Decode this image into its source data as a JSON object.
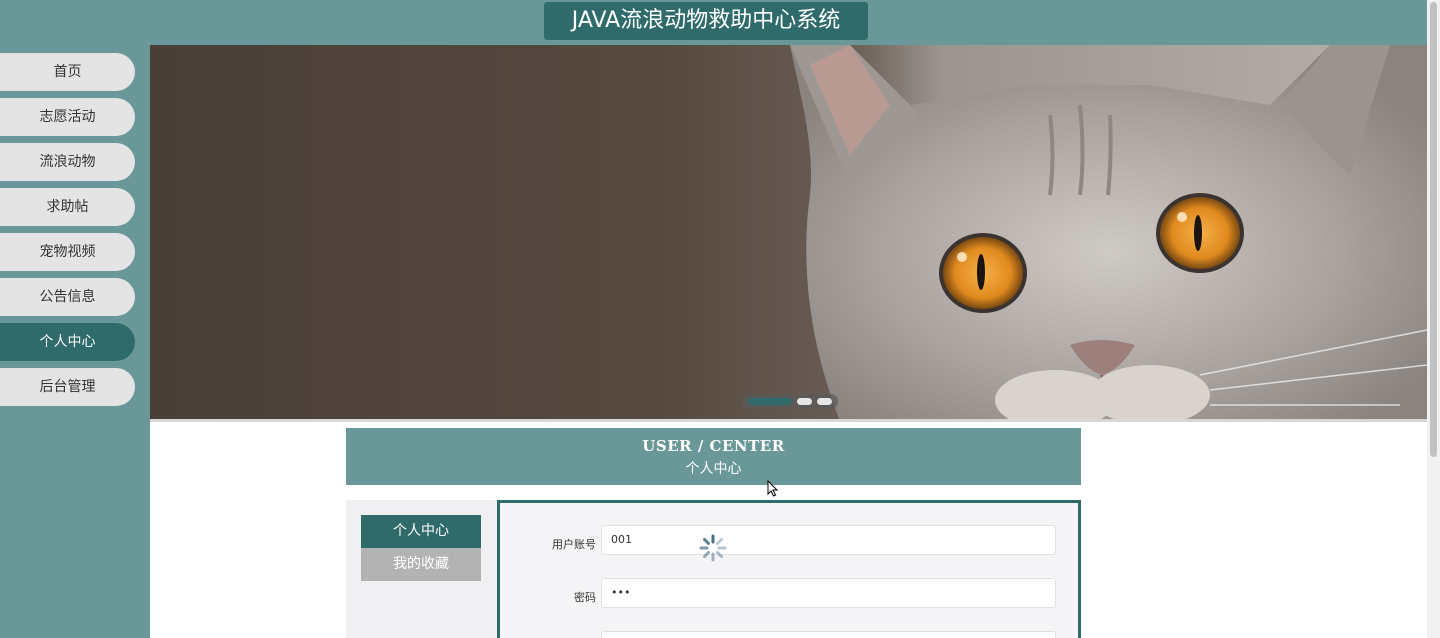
{
  "header": {
    "title": "JAVA流浪动物救助中心系统"
  },
  "sidebar": {
    "items": [
      {
        "label": "首页"
      },
      {
        "label": "志愿活动"
      },
      {
        "label": "流浪动物"
      },
      {
        "label": "求助帖"
      },
      {
        "label": "宠物视频"
      },
      {
        "label": "公告信息"
      },
      {
        "label": "个人中心",
        "active": true
      },
      {
        "label": "后台管理"
      }
    ]
  },
  "banner": {
    "slide_count": 3,
    "active_slide": 1
  },
  "section": {
    "title_en": "USER / CENTER",
    "title_cn": "个人中心"
  },
  "side_tabs": [
    {
      "label": "个人中心",
      "active": true
    },
    {
      "label": "我的收藏",
      "active": false
    }
  ],
  "form": {
    "fields": [
      {
        "label": "用户账号",
        "value": "001"
      },
      {
        "label": "密码",
        "value": "•••"
      },
      {
        "label": "",
        "value": ""
      }
    ]
  },
  "colors": {
    "primary": "#2f6b6b",
    "secondary": "#6a9899",
    "inactive": "#b3b3b3"
  },
  "icons": [
    "loading-spinner-icon",
    "mouse-pointer-icon"
  ]
}
